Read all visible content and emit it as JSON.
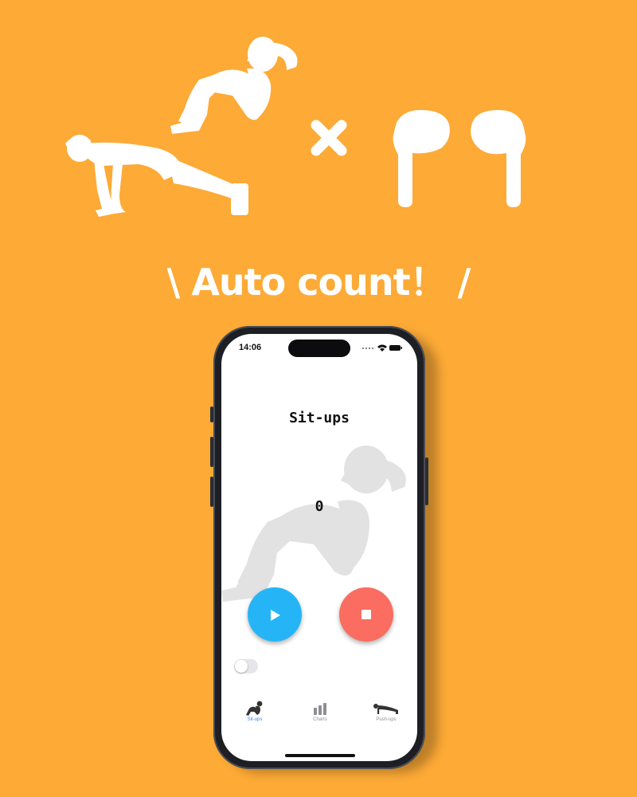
{
  "hero": {
    "tagline": "\\ Auto count！ /",
    "icons": [
      "push-up-figure",
      "sit-up-figure",
      "times-sign",
      "earbuds"
    ]
  },
  "phone": {
    "status": {
      "time": "14:06"
    },
    "screen_title": "Sit-ups",
    "count": "0",
    "tabs": [
      {
        "label": "Sit-ups",
        "icon": "sit-up-icon",
        "active": true
      },
      {
        "label": "Charts",
        "icon": "bar-chart-icon",
        "active": false
      },
      {
        "label": "Push-ups",
        "icon": "push-up-icon",
        "active": false
      }
    ],
    "colors": {
      "background": "#FDAA36",
      "play": "#25B5F7",
      "stop": "#FA6D60",
      "active_tab": "#2F8AF5"
    }
  }
}
